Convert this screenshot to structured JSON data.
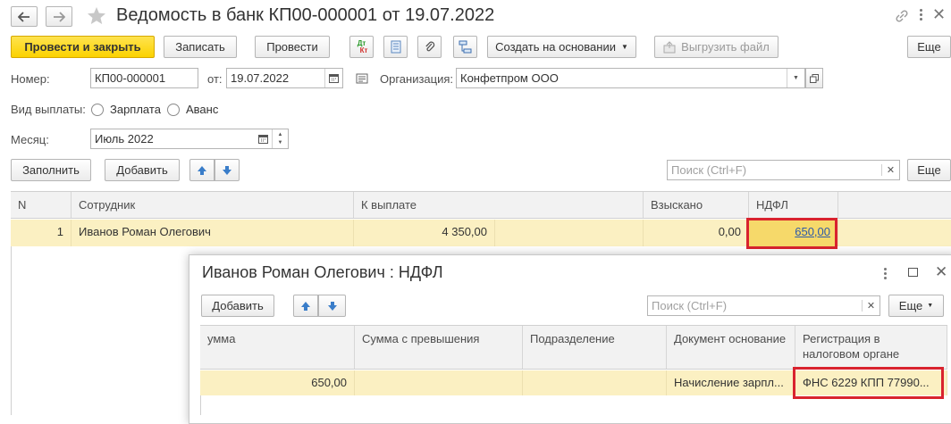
{
  "window": {
    "title": "Ведомость в банк КП00-000001 от 19.07.2022"
  },
  "toolbar": {
    "post_and_close": "Провести и закрыть",
    "save": "Записать",
    "post": "Провести",
    "dt_kt_top": "Дт",
    "dt_kt_bottom": "Кт",
    "create_based_on": "Создать на основании",
    "export_file": "Выгрузить файл",
    "more": "Еще"
  },
  "form": {
    "number_label": "Номер:",
    "number_value": "КП00-000001",
    "date_label": "от:",
    "date_value": "19.07.2022",
    "org_label": "Организация:",
    "org_value": "Конфетпром ООО",
    "payment_type_label": "Вид выплаты:",
    "payment_options": [
      "Зарплата",
      "Аванс"
    ],
    "month_label": "Месяц:",
    "month_value": "Июль 2022"
  },
  "table_toolbar": {
    "fill": "Заполнить",
    "add": "Добавить",
    "search_placeholder": "Поиск (Ctrl+F)",
    "more": "Еще"
  },
  "table": {
    "columns": [
      "N",
      "Сотрудник",
      "К выплате",
      "Взыскано",
      "НДФЛ"
    ],
    "rows": [
      {
        "n": "1",
        "employee": "Иванов Роман Олегович",
        "to_pay": "4 350,00",
        "withheld": "0,00",
        "ndfl": "650,00"
      }
    ]
  },
  "popup": {
    "title": "Иванов Роман Олегович : НДФЛ",
    "add": "Добавить",
    "search_placeholder": "Поиск (Ctrl+F)",
    "more": "Еще",
    "columns": [
      "умма",
      "Сумма с превышения",
      "Подразделение",
      "Документ основание",
      "Регистрация в",
      "налоговом органе"
    ],
    "row": {
      "sum": "650,00",
      "excess": "",
      "department": "",
      "base_doc": "Начисление зарпл...",
      "registration": "ФНС 6229 КПП 77990..."
    }
  },
  "colors": {
    "accent_yellow": "#fbd200",
    "row_highlight": "#fbf0c2",
    "annotation_red": "#d9232e"
  }
}
